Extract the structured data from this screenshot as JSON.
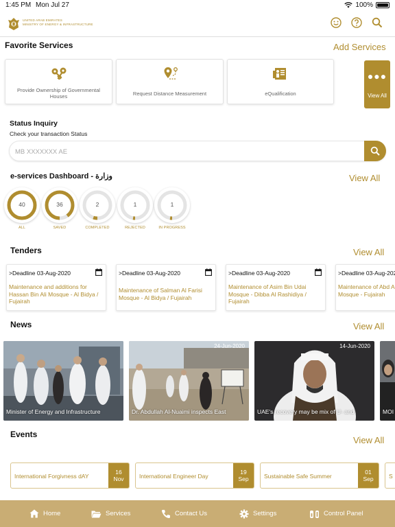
{
  "status_bar": {
    "time": "1:45 PM",
    "date": "Mon Jul 27",
    "battery": "100%"
  },
  "header": {
    "ministry_en_line1": "UNITED ARAB EMIRATES",
    "ministry_en_line2": "MINISTRY OF ENERGY & INFRASTRUCTURE"
  },
  "favorites": {
    "title": "Favorite Services",
    "add_label": "Add Services",
    "items": [
      {
        "label": "Provide Ownership of Governmental Houses",
        "icon": "keys-icon"
      },
      {
        "label": "Request Distance Measurement",
        "icon": "map-pin-icon"
      },
      {
        "label": "eQualification",
        "icon": "certificate-icon"
      }
    ],
    "view_all_label": "View All"
  },
  "status_inquiry": {
    "title": "Status Inquiry",
    "subtitle": "Check your transaction Status",
    "placeholder": "MB XXXXXXX AE"
  },
  "dashboard": {
    "title": "e-services Dashboard - وزارة",
    "view_all": "View All",
    "rings": [
      {
        "value": "40",
        "label": "ALL",
        "fill": 1.0
      },
      {
        "value": "36",
        "label": "SAVED",
        "fill": 0.9
      },
      {
        "value": "2",
        "label": "COMPLETED",
        "fill": 0.05
      },
      {
        "value": "1",
        "label": "REJECTED",
        "fill": 0.025
      },
      {
        "value": "1",
        "label": "IN PROGRESS",
        "fill": 0.025
      }
    ]
  },
  "tenders": {
    "title": "Tenders",
    "view_all": "View All",
    "items": [
      {
        "deadline": ">Deadline 03-Aug-2020",
        "title": "Maintenance and additions for Hassan Bin Ali Mosque - Al Bidya / Fujairah"
      },
      {
        "deadline": ">Deadline 03-Aug-2020",
        "title": "Maintenance of Salman Al Farisi Mosque - Al Bidya / Fujairah"
      },
      {
        "deadline": ">Deadline 03-Aug-2020",
        "title": "Maintenance of Asim Bin Udai Mosque - Dibba Al Rashidiya / Fujairah"
      },
      {
        "deadline": ">Deadline 03-Aug-2020",
        "title": "Maintenance of Abd Al-Nasser Mosque - Fujairah"
      }
    ]
  },
  "news": {
    "title": "News",
    "view_all": "View All",
    "items": [
      {
        "date": "",
        "caption": "Minister of Energy and Infrastructure"
      },
      {
        "date": "24-Jun-2020",
        "caption": "Dr. Abdullah Al-Nuaimi inspects East"
      },
      {
        "date": "14-Jun-2020",
        "caption": "UAE's recovery may be mix of U- and"
      },
      {
        "date": "",
        "caption": "MOI"
      }
    ]
  },
  "events": {
    "title": "Events",
    "view_all": "View All",
    "items": [
      {
        "title": "International Forgivness dAY",
        "day": "16",
        "month": "Nov"
      },
      {
        "title": "International Engineer Day",
        "day": "19",
        "month": "Sep"
      },
      {
        "title": "Sustainable Safe Summer",
        "day": "01",
        "month": "Sep"
      },
      {
        "title": "S",
        "day": "",
        "month": ""
      }
    ]
  },
  "tabbar": {
    "items": [
      {
        "label": "Home",
        "icon": "home-icon"
      },
      {
        "label": "Services",
        "icon": "folder-icon"
      },
      {
        "label": "Contact Us",
        "icon": "phone-icon"
      },
      {
        "label": "Settings",
        "icon": "gear-icon"
      },
      {
        "label": "Control Panel",
        "icon": "control-panel-icon"
      }
    ]
  },
  "colors": {
    "accent": "#b08d2f",
    "tabbar": "#c9ad74"
  }
}
